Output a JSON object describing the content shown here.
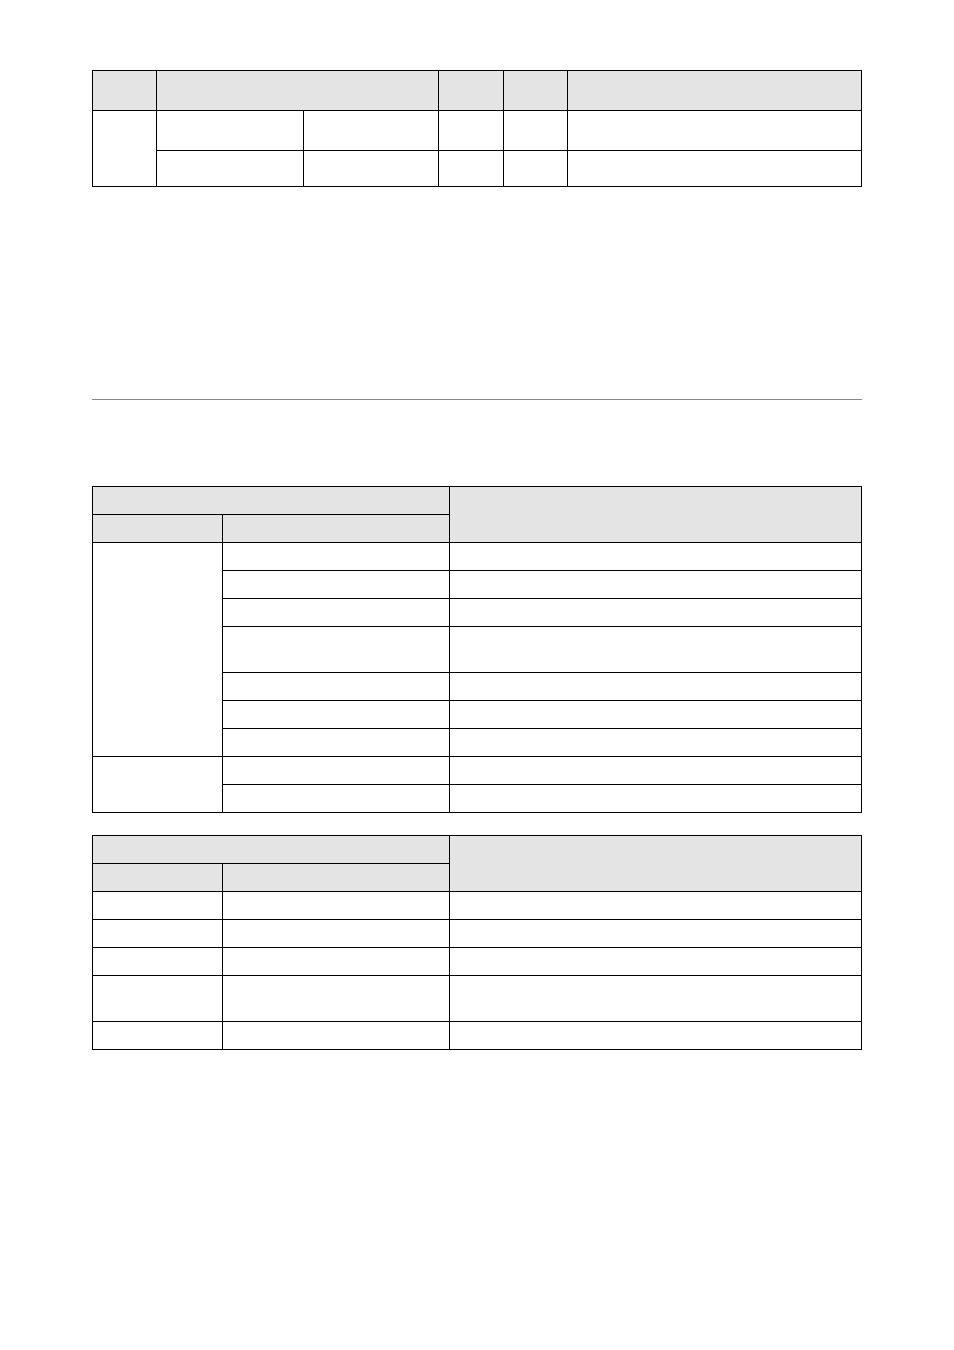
{
  "table1": {
    "headers": [
      "",
      "",
      "",
      "",
      ""
    ],
    "rows": [
      {
        "c0_rowspan": 2,
        "c1": "",
        "c2": "",
        "c3": "",
        "c4": "",
        "c5": ""
      },
      {
        "c1": "",
        "c2": "",
        "c3": "",
        "c4": "",
        "c5": ""
      }
    ]
  },
  "section_heading": "",
  "table2": {
    "top_left": "",
    "top_right": "",
    "sub_left": "",
    "sub_right": "",
    "groups": [
      {
        "label": "",
        "rowspan": 7,
        "rows": [
          {
            "c2": "",
            "c3": "",
            "h": "s"
          },
          {
            "c2": "",
            "c3": "",
            "h": "s"
          },
          {
            "c2": "",
            "c3": "",
            "h": "s"
          },
          {
            "c2": "",
            "c3": "",
            "h": "l"
          },
          {
            "c2": "",
            "c3": "",
            "h": "s"
          },
          {
            "c2": "",
            "c3": "",
            "h": "s"
          },
          {
            "c2": "",
            "c3": "",
            "h": "s"
          }
        ]
      },
      {
        "label": "",
        "rowspan": 2,
        "rows": [
          {
            "c2": "",
            "c3": "",
            "h": "s"
          },
          {
            "c2": "",
            "c3": "",
            "h": "s"
          }
        ]
      }
    ]
  },
  "table3": {
    "top_left": "",
    "top_right": "",
    "sub_left": "",
    "sub_right": "",
    "rows": [
      {
        "c1": "",
        "c2": "",
        "c3": "",
        "h": "s"
      },
      {
        "c1": "",
        "c2": "",
        "c3": "",
        "h": "s"
      },
      {
        "c1": "",
        "c2": "",
        "c3": "",
        "h": "s"
      },
      {
        "c1": "",
        "c2": "",
        "c3": "",
        "h": "l"
      },
      {
        "c1": "",
        "c2": "",
        "c3": "",
        "h": "s"
      }
    ]
  }
}
